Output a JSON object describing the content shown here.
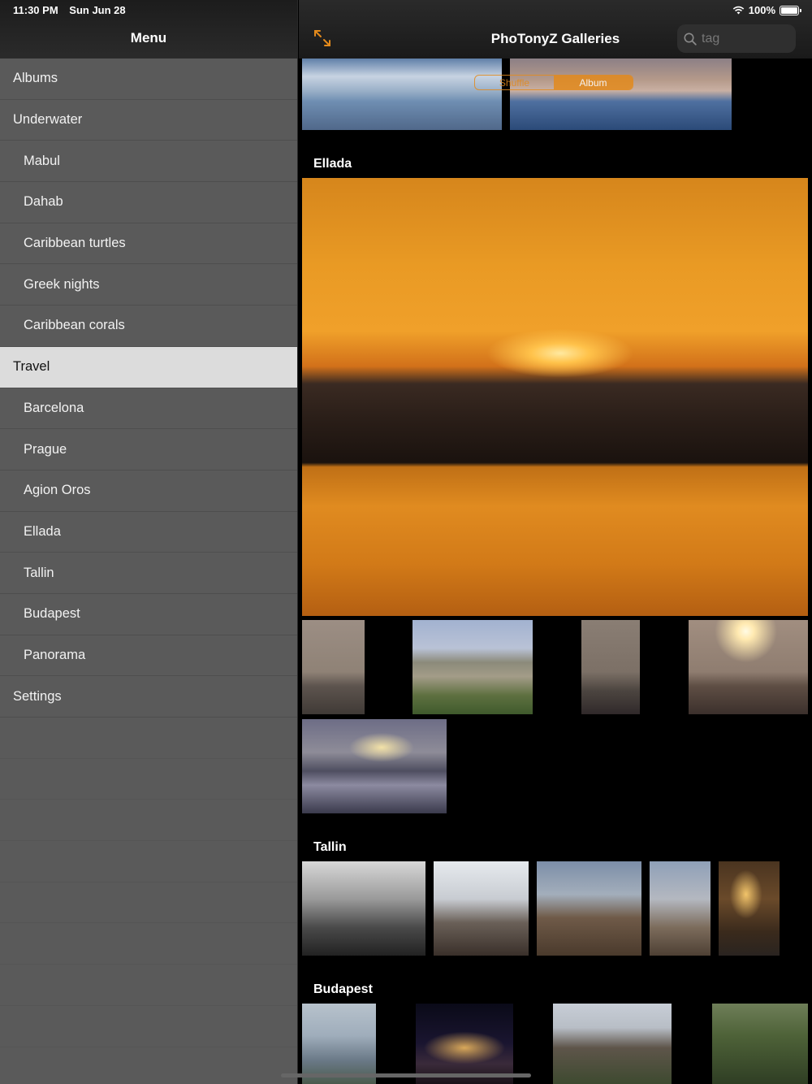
{
  "status_bar": {
    "time": "11:30 PM",
    "date": "Sun Jun 28",
    "battery": "100%"
  },
  "sidebar": {
    "title": "Menu",
    "items": [
      {
        "label": "Albums",
        "level": 0,
        "selected": false
      },
      {
        "label": "Underwater",
        "level": 0,
        "selected": false
      },
      {
        "label": "Mabul",
        "level": 1,
        "selected": false
      },
      {
        "label": "Dahab",
        "level": 1,
        "selected": false
      },
      {
        "label": "Caribbean turtles",
        "level": 1,
        "selected": false
      },
      {
        "label": "Greek nights",
        "level": 1,
        "selected": false
      },
      {
        "label": "Caribbean corals",
        "level": 1,
        "selected": false
      },
      {
        "label": "Travel",
        "level": 0,
        "selected": true
      },
      {
        "label": "Barcelona",
        "level": 1,
        "selected": false
      },
      {
        "label": "Prague",
        "level": 1,
        "selected": false
      },
      {
        "label": "Agion Oros",
        "level": 1,
        "selected": false
      },
      {
        "label": "Ellada",
        "level": 1,
        "selected": false
      },
      {
        "label": "Tallin",
        "level": 1,
        "selected": false
      },
      {
        "label": "Budapest",
        "level": 1,
        "selected": false
      },
      {
        "label": "Panorama",
        "level": 1,
        "selected": false
      },
      {
        "label": "Settings",
        "level": 0,
        "selected": false
      }
    ]
  },
  "header": {
    "title": "PhoTonyZ Galleries",
    "search_placeholder": "tag",
    "accent_color": "#e38a1c"
  },
  "segment": {
    "options": [
      "Shuffle",
      "Album"
    ],
    "selected": "Album"
  },
  "sections": {
    "ellada": {
      "title": "Ellada"
    },
    "tallin": {
      "title": "Tallin"
    },
    "budapest": {
      "title": "Budapest"
    }
  }
}
